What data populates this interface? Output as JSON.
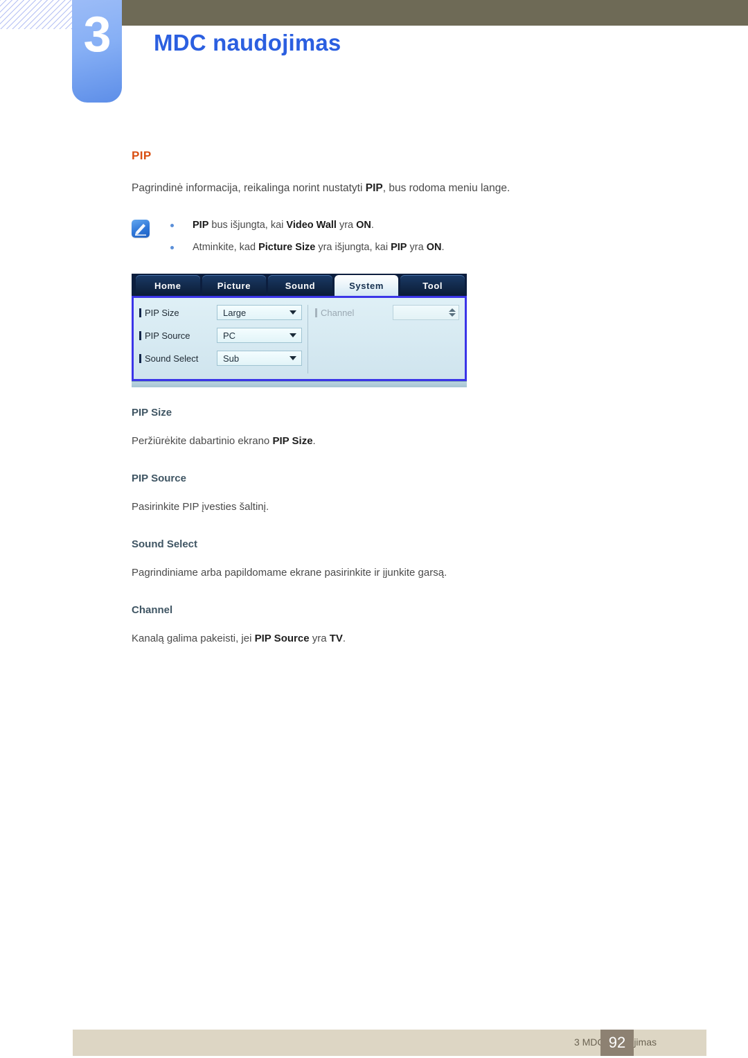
{
  "header": {
    "chapter_number": "3",
    "chapter_title": "MDC naudojimas",
    "accent_blue": "#2b5fe0",
    "olive": "#6e6a56"
  },
  "section": {
    "title": "PIP",
    "title_color": "#d94f12",
    "intro_before": "Pagrindinė informacija, reikalinga norint nustatyti ",
    "intro_bold": "PIP",
    "intro_after": ", bus rodoma meniu lange."
  },
  "note": {
    "icon_name": "note-pen-icon",
    "bullets": [
      {
        "p1": "PIP",
        "p2": " bus išjungta, kai ",
        "p3": "Video Wall",
        "p4": " yra ",
        "p5": "ON",
        "p6": "."
      },
      {
        "p1": "Atminkite, kad ",
        "p2": "Picture Size",
        "p3": " yra išjungta, kai ",
        "p4": "PIP",
        "p5": " yra ",
        "p6": "ON",
        "p7": "."
      }
    ]
  },
  "mdc_window": {
    "tabs": [
      {
        "label": "Home",
        "active": false
      },
      {
        "label": "Picture",
        "active": false
      },
      {
        "label": "Sound",
        "active": false
      },
      {
        "label": "System",
        "active": true
      },
      {
        "label": "Tool",
        "active": false
      }
    ],
    "left_controls": [
      {
        "label": "PIP Size",
        "value": "Large",
        "type": "select",
        "disabled": false
      },
      {
        "label": "PIP Source",
        "value": "PC",
        "type": "select",
        "disabled": false
      },
      {
        "label": "Sound Select",
        "value": "Sub",
        "type": "select",
        "disabled": false
      }
    ],
    "right_controls": [
      {
        "label": "Channel",
        "value": "",
        "type": "spinner",
        "disabled": true
      }
    ],
    "border_color": "#3b35e8"
  },
  "articles": [
    {
      "heading": "PIP Size",
      "body_before": "Peržiūrėkite dabartinio ekrano ",
      "body_bold": "PIP Size",
      "body_after": "."
    },
    {
      "heading": "PIP Source",
      "body_before": "Pasirinkite PIP įvesties šaltinį.",
      "body_bold": "",
      "body_after": ""
    },
    {
      "heading": "Sound Select",
      "body_before": "Pagrindiniame arba papildomame ekrane pasirinkite ir įjunkite garsą.",
      "body_bold": "",
      "body_after": ""
    },
    {
      "heading": "Channel",
      "body_before": "Kanalą galima pakeisti, jei ",
      "body_bold": "PIP Source",
      "body_after": " yra ",
      "body_bold2": "TV",
      "body_after2": "."
    }
  ],
  "footer": {
    "text": "3 MDC naudojimas",
    "page_number": "92",
    "band_color": "#ddd6c4",
    "page_box_color": "#8d8172"
  }
}
